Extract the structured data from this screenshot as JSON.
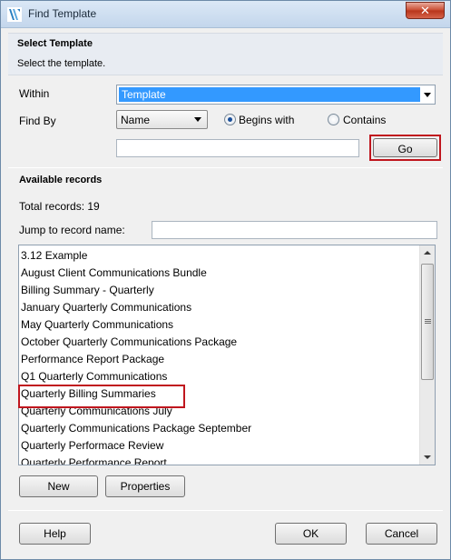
{
  "window": {
    "title": "Find Template"
  },
  "header": {
    "title": "Select Template",
    "subtitle": "Select the template."
  },
  "within": {
    "label": "Within",
    "value": "Template"
  },
  "find_by": {
    "label": "Find By",
    "field": "Name",
    "options": [
      "Begins with",
      "Contains"
    ],
    "selected": "Begins with"
  },
  "search": {
    "value": "",
    "go_label": "Go"
  },
  "records": {
    "section_title": "Available records",
    "total_label": "Total records: 19",
    "jump_label": "Jump to record name:",
    "jump_value": ""
  },
  "list": {
    "items": [
      "3.12 Example",
      "August Client Communications Bundle",
      "Billing Summary - Quarterly",
      "January Quarterly Communications",
      "May Quarterly Communications",
      "October Quarterly Communications Package",
      "Performance Report Package",
      "Q1 Quarterly Communications",
      "Quarterly Billing Summaries",
      "Quarterly Communications July",
      "Quarterly Communications Package September",
      "Quarterly Performace Review",
      "Quarterly Performance Report"
    ],
    "highlighted": "Quarterly Billing Summaries"
  },
  "buttons": {
    "new": "New",
    "properties": "Properties",
    "help": "Help",
    "ok": "OK",
    "cancel": "Cancel"
  },
  "colors": {
    "selection": "#3399ff",
    "highlight_box": "#c0161e"
  }
}
